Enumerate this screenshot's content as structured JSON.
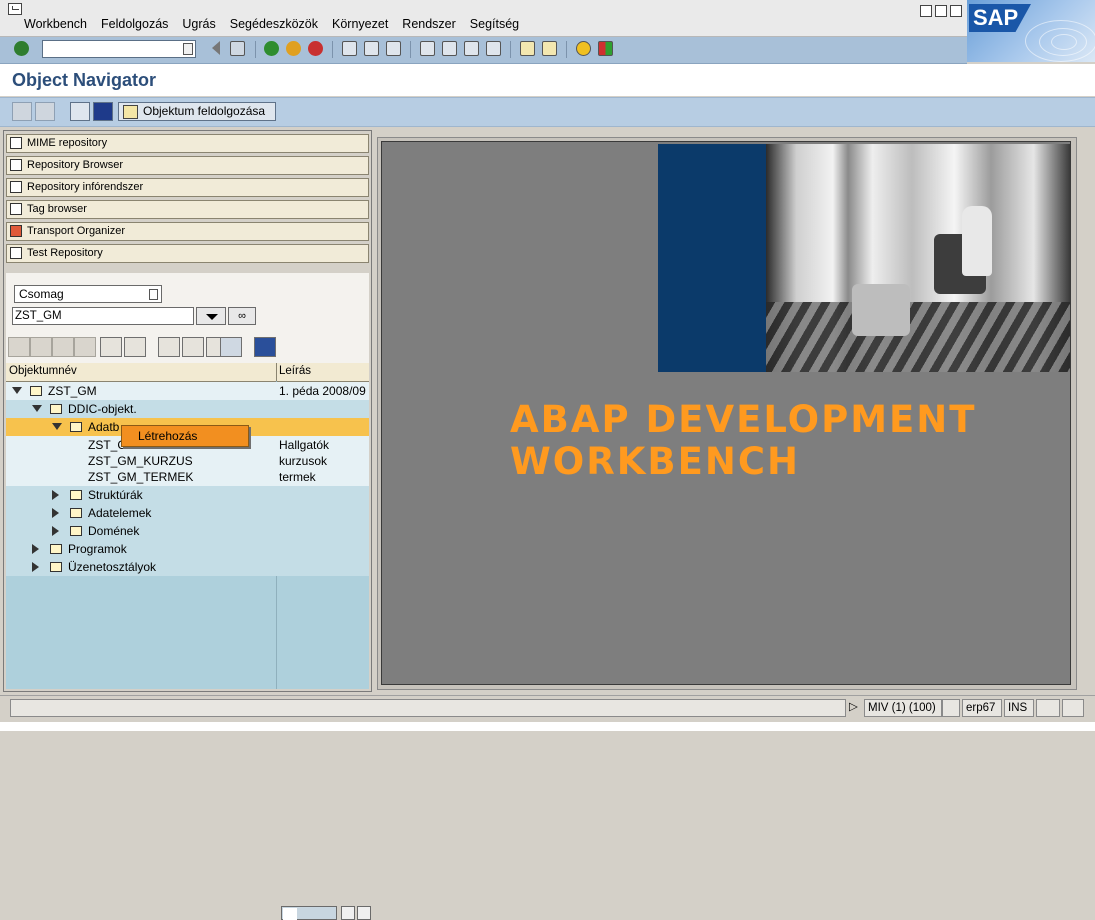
{
  "menubar": {
    "items": [
      "Workbench",
      "Feldolgozás",
      "Ugrás",
      "Segédeszközök",
      "Környezet",
      "Rendszer",
      "Segítség"
    ],
    "logo": "SAP"
  },
  "toolbar": {
    "okcode_value": "",
    "icons": [
      "enter-check-icon",
      "back-icon",
      "exit-icon",
      "cancel-icon",
      "print-icon",
      "find-icon",
      "find-next-icon",
      "first-page-icon",
      "previous-page-icon",
      "next-page-icon",
      "last-page-icon",
      "create-session-icon",
      "shortcut-icon",
      "help-icon",
      "layout-icon"
    ]
  },
  "page": {
    "title": "Object Navigator"
  },
  "apptoolbar": {
    "edit_object_label": "Objektum feldolgozása"
  },
  "navigator": {
    "buttons": [
      "MIME repository",
      "Repository Browser",
      "Repository infórendszer",
      "Tag browser",
      "Transport Organizer",
      "Test Repository"
    ],
    "object_type": "Csomag",
    "object_name": "ZST_GM"
  },
  "tree": {
    "columns": {
      "name": "Objektumnév",
      "desc": "Leírás"
    },
    "rows": [
      {
        "name": "ZST_GM",
        "desc": "1. péda 2008/09"
      },
      {
        "name": "DDIC-objekt.",
        "desc": ""
      },
      {
        "name": "Adatb",
        "desc": ""
      },
      {
        "name": "ZST_G",
        "desc": "Hallgatók"
      },
      {
        "name": "ZST_GM_KURZUS",
        "desc": "kurzusok"
      },
      {
        "name": "ZST_GM_TERMEK",
        "desc": "termek"
      },
      {
        "name": "Struktúrák",
        "desc": ""
      },
      {
        "name": "Adatelemek",
        "desc": ""
      },
      {
        "name": "Domének",
        "desc": ""
      },
      {
        "name": "Programok",
        "desc": ""
      },
      {
        "name": "Üzenetosztályok",
        "desc": ""
      }
    ]
  },
  "context_menu": {
    "item": "Létrehozás"
  },
  "banner": {
    "line1": "ABAP DEVELOPMENT",
    "line2": "WORKBENCH"
  },
  "status": {
    "message": "",
    "system": "MIV (1) (100)",
    "server": "erp67",
    "mode": "INS"
  },
  "colors": {
    "accent_orange": "#ff9a1f",
    "selection": "#f7c24d",
    "tree_bg": "#aed0dc",
    "title_blue": "#2c4e7a"
  }
}
